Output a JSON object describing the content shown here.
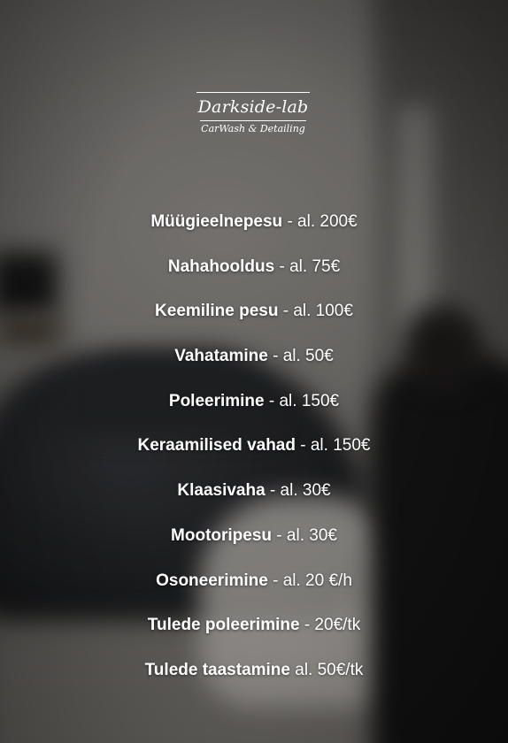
{
  "logo": {
    "name": "Darkside-lab",
    "tagline": "CarWash & Detailing"
  },
  "services": [
    {
      "name": "Müügieelnepesu",
      "price": " - al. 200€"
    },
    {
      "name": "Nahahooldus",
      "price": " - al. 75€"
    },
    {
      "name": "Keemiline pesu",
      "price": " - al. 100€"
    },
    {
      "name": "Vahatamine",
      "price": " - al. 50€"
    },
    {
      "name": "Poleerimine",
      "price": " - al. 150€"
    },
    {
      "name": "Keraamilised vahad",
      "price": " - al. 150€"
    },
    {
      "name": "Klaasivaha",
      "price": " - al. 30€"
    },
    {
      "name": "Mootoripesu",
      "price": " - al. 30€"
    },
    {
      "name": "Osoneerimine",
      "price": " - al. 20 €/h"
    },
    {
      "name": "Tulede poleerimine",
      "price": " - 20€/tk"
    },
    {
      "name": "Tulede taastamine",
      "price": " al. 50€/tk"
    }
  ]
}
